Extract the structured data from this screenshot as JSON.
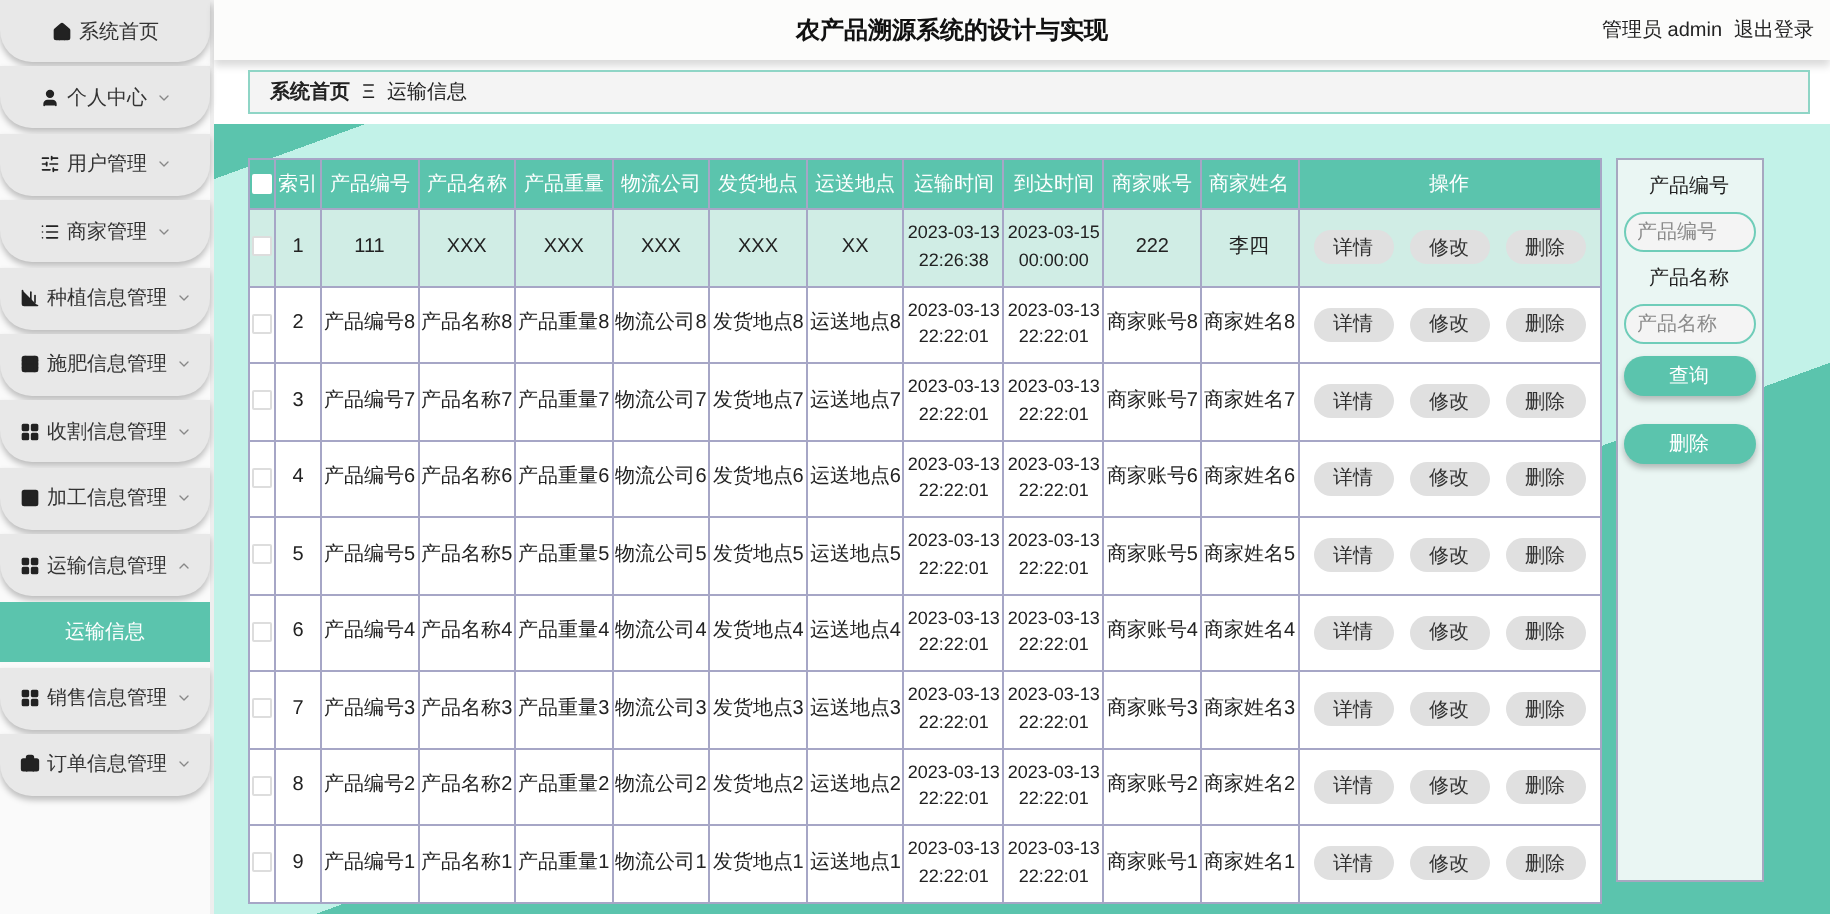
{
  "header": {
    "title": "农产品溯源系统的设计与实现",
    "user": "管理员 admin",
    "logout": "退出登录"
  },
  "sidebar": {
    "items": [
      {
        "label": "系统首页"
      },
      {
        "label": "个人中心",
        "expanded": false
      },
      {
        "label": "用户管理",
        "expanded": false
      },
      {
        "label": "商家管理",
        "expanded": false
      },
      {
        "label": "种植信息管理",
        "expanded": false
      },
      {
        "label": "施肥信息管理",
        "expanded": false
      },
      {
        "label": "收割信息管理",
        "expanded": false
      },
      {
        "label": "加工信息管理",
        "expanded": false
      },
      {
        "label": "运输信息管理",
        "expanded": true,
        "children": [
          {
            "label": "运输信息",
            "selected": true
          }
        ]
      },
      {
        "label": "销售信息管理",
        "expanded": false
      },
      {
        "label": "订单信息管理",
        "expanded": false
      }
    ]
  },
  "breadcrumb": {
    "items": [
      "系统首页",
      "运输信息"
    ],
    "separator": "Ξ"
  },
  "table": {
    "select_all_checked": false,
    "columns": [
      "索引",
      "产品编号",
      "产品名称",
      "产品重量",
      "物流公司",
      "发货地点",
      "运送地点",
      "运输时间",
      "到达时间",
      "商家账号",
      "商家姓名",
      "操作"
    ],
    "rows": [
      {
        "selected": true,
        "checked": false,
        "actions": [
          "详情",
          "修改",
          "删除"
        ],
        "cells": [
          "1",
          "111",
          "XXX",
          "XXX",
          "XXX",
          "XXX",
          "XX",
          "2023-03-13 22:26:38",
          "2023-03-15 00:00:00",
          "222",
          "李四"
        ]
      },
      {
        "selected": false,
        "checked": false,
        "actions": [
          "详情",
          "修改",
          "删除"
        ],
        "cells": [
          "2",
          "产品编号8",
          "产品名称8",
          "产品重量8",
          "物流公司8",
          "发货地点8",
          "运送地点8",
          "2023-03-13 22:22:01",
          "2023-03-13 22:22:01",
          "商家账号8",
          "商家姓名8"
        ]
      },
      {
        "selected": false,
        "checked": false,
        "actions": [
          "详情",
          "修改",
          "删除"
        ],
        "cells": [
          "3",
          "产品编号7",
          "产品名称7",
          "产品重量7",
          "物流公司7",
          "发货地点7",
          "运送地点7",
          "2023-03-13 22:22:01",
          "2023-03-13 22:22:01",
          "商家账号7",
          "商家姓名7"
        ]
      },
      {
        "selected": false,
        "checked": false,
        "actions": [
          "详情",
          "修改",
          "删除"
        ],
        "cells": [
          "4",
          "产品编号6",
          "产品名称6",
          "产品重量6",
          "物流公司6",
          "发货地点6",
          "运送地点6",
          "2023-03-13 22:22:01",
          "2023-03-13 22:22:01",
          "商家账号6",
          "商家姓名6"
        ]
      },
      {
        "selected": false,
        "checked": false,
        "actions": [
          "详情",
          "修改",
          "删除"
        ],
        "cells": [
          "5",
          "产品编号5",
          "产品名称5",
          "产品重量5",
          "物流公司5",
          "发货地点5",
          "运送地点5",
          "2023-03-13 22:22:01",
          "2023-03-13 22:22:01",
          "商家账号5",
          "商家姓名5"
        ]
      },
      {
        "selected": false,
        "checked": false,
        "actions": [
          "详情",
          "修改",
          "删除"
        ],
        "cells": [
          "6",
          "产品编号4",
          "产品名称4",
          "产品重量4",
          "物流公司4",
          "发货地点4",
          "运送地点4",
          "2023-03-13 22:22:01",
          "2023-03-13 22:22:01",
          "商家账号4",
          "商家姓名4"
        ]
      },
      {
        "selected": false,
        "checked": false,
        "actions": [
          "详情",
          "修改",
          "删除"
        ],
        "cells": [
          "7",
          "产品编号3",
          "产品名称3",
          "产品重量3",
          "物流公司3",
          "发货地点3",
          "运送地点3",
          "2023-03-13 22:22:01",
          "2023-03-13 22:22:01",
          "商家账号3",
          "商家姓名3"
        ]
      },
      {
        "selected": false,
        "checked": false,
        "actions": [
          "详情",
          "修改",
          "删除"
        ],
        "cells": [
          "8",
          "产品编号2",
          "产品名称2",
          "产品重量2",
          "物流公司2",
          "发货地点2",
          "运送地点2",
          "2023-03-13 22:22:01",
          "2023-03-13 22:22:01",
          "商家账号2",
          "商家姓名2"
        ]
      },
      {
        "selected": false,
        "checked": false,
        "actions": [
          "详情",
          "修改",
          "删除"
        ],
        "cells": [
          "9",
          "产品编号1",
          "产品名称1",
          "产品重量1",
          "物流公司1",
          "发货地点1",
          "运送地点1",
          "2023-03-13 22:22:01",
          "2023-03-13 22:22:01",
          "商家账号1",
          "商家姓名1"
        ]
      }
    ]
  },
  "search": {
    "fields": [
      {
        "label": "产品编号",
        "placeholder": "产品编号"
      },
      {
        "label": "产品名称",
        "placeholder": "产品名称"
      }
    ],
    "buttons": [
      "查询",
      "删除"
    ]
  }
}
